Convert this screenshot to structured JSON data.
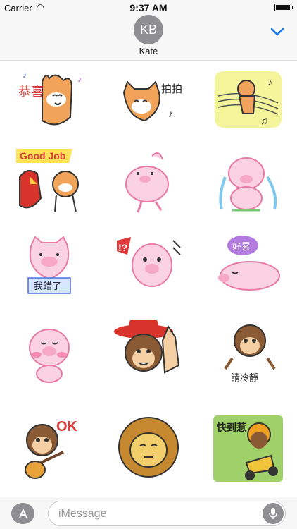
{
  "status": {
    "carrier": "Carrier",
    "time": "9:37 AM"
  },
  "header": {
    "initials": "KB",
    "contact_name": "Kate"
  },
  "composer": {
    "placeholder": "iMessage"
  },
  "stickers": [
    {
      "name": "cat-congrats-sticker",
      "text": "恭喜"
    },
    {
      "name": "cat-applause-sticker",
      "text": "拍拍"
    },
    {
      "name": "cat-music-sticker",
      "text": ""
    },
    {
      "name": "parrot-cat-good-job-sticker",
      "text": "Good Job"
    },
    {
      "name": "pig-dancing-sticker",
      "text": ""
    },
    {
      "name": "pig-crying-sticker",
      "text": ""
    },
    {
      "name": "pig-sorry-sticker",
      "text": "我錯了"
    },
    {
      "name": "pig-shocked-sticker",
      "text": "!?"
    },
    {
      "name": "pig-sleepy-sticker",
      "text": "好累"
    },
    {
      "name": "pig-blushing-sticker",
      "text": ""
    },
    {
      "name": "monkey-thumbs-up-sticker",
      "text": ""
    },
    {
      "name": "monkey-calm-down-sticker",
      "text": "請冷靜"
    },
    {
      "name": "monkey-ok-guitar-sticker",
      "text": "OK"
    },
    {
      "name": "lion-sticker",
      "text": ""
    },
    {
      "name": "monkey-scooter-sticker",
      "text": "快到惹"
    }
  ]
}
